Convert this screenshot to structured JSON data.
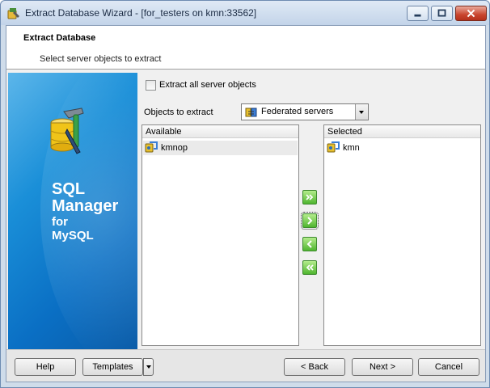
{
  "window": {
    "title": "Extract Database Wizard - [for_testers on kmn:33562]"
  },
  "header": {
    "title": "Extract Database",
    "subtitle": "Select server objects to extract"
  },
  "banner": {
    "line1": "SQL",
    "line2": "Manager",
    "line3": "for",
    "line4": "MySQL"
  },
  "options": {
    "extract_all_label": "Extract all server objects",
    "extract_all_checked": false,
    "objects_label": "Objects to extract",
    "objects_value": "Federated servers"
  },
  "available": {
    "header": "Available",
    "items": [
      {
        "label": "kmnop",
        "icon": "server-icon"
      }
    ]
  },
  "selected": {
    "header": "Selected",
    "items": [
      {
        "label": "kmn",
        "icon": "server-icon"
      }
    ]
  },
  "footer": {
    "help": "Help",
    "templates": "Templates",
    "back": "< Back",
    "next": "Next >",
    "cancel": "Cancel"
  }
}
